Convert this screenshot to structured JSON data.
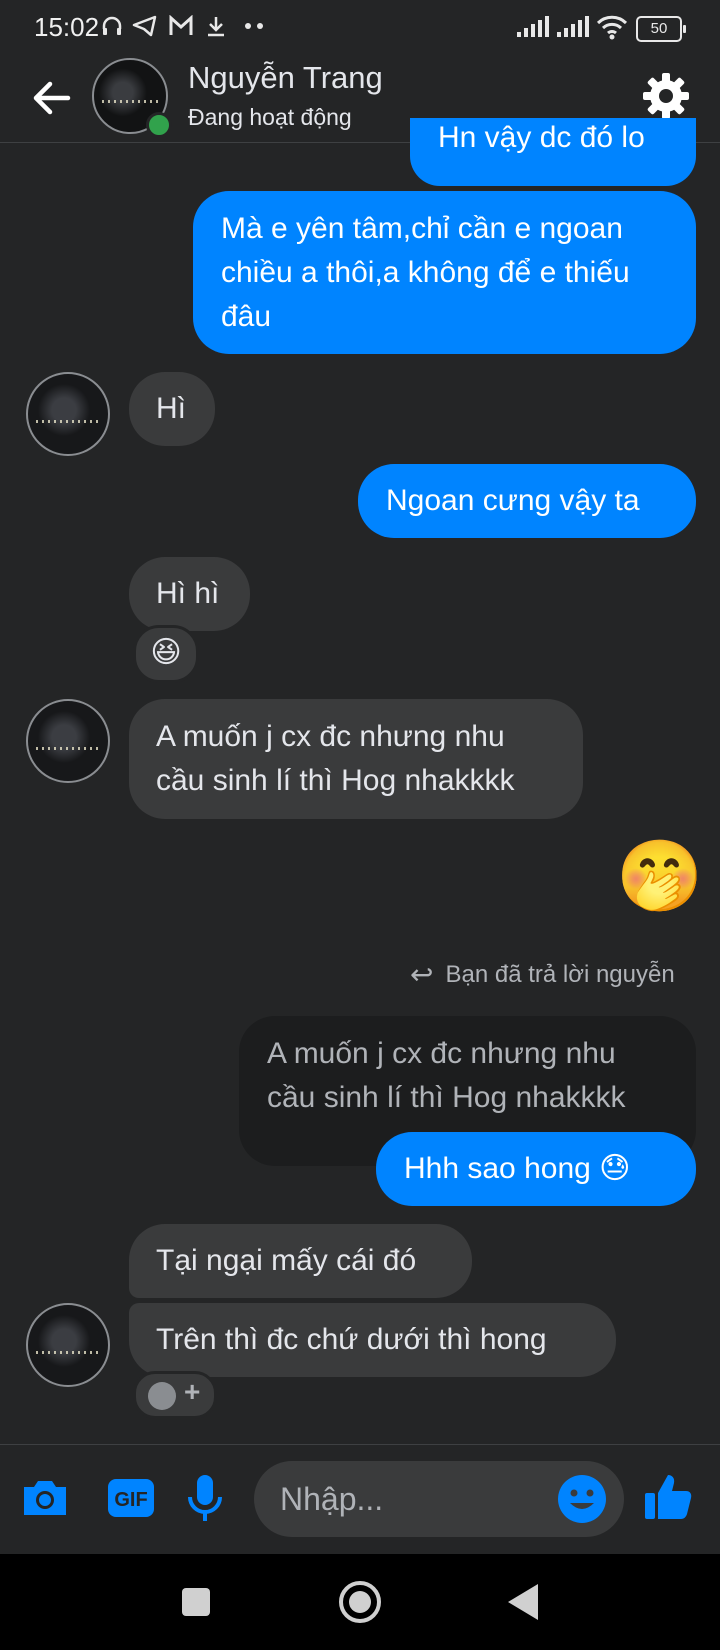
{
  "status_bar": {
    "time": "15:02",
    "battery": "50",
    "icons": [
      "headset-icon",
      "telegram-icon",
      "gmail-icon",
      "download-icon",
      "more-dots-icon",
      "signal-icon",
      "signal-icon",
      "wifi-icon",
      "battery-icon"
    ]
  },
  "header": {
    "name": "Nguyễn Trang",
    "status": "Đang hoạt động"
  },
  "messages": [
    {
      "dir": "out",
      "text": "Hn vậy dc đó lo"
    },
    {
      "dir": "out",
      "text": "Mà e yên tâm,chỉ cần e ngoan chiều a thôi,a không để e thiếu đâu"
    },
    {
      "dir": "in",
      "text": "Hì"
    },
    {
      "dir": "out",
      "text": "Ngoan cưng vậy ta"
    },
    {
      "dir": "in",
      "text": "Hì hì",
      "reaction": "😆"
    },
    {
      "dir": "in",
      "text": "A muốn j cx đc nhưng nhu cầu sinh lí thì Hog nhakkkk"
    },
    {
      "dir": "out",
      "text": "🤭"
    },
    {
      "dir": "out",
      "text": "Hhh sao hong 😓"
    },
    {
      "dir": "in",
      "text": "Tại ngại mấy cái đó"
    },
    {
      "dir": "in",
      "text": "Trên thì đc chứ dưới thì hong"
    }
  ],
  "reply": {
    "label": "Bạn đã trả lời nguyễn",
    "quoted": "A muốn j cx đc nhưng nhu cầu sinh lí thì Hog nhakkkk"
  },
  "composer": {
    "placeholder": "Nhập..."
  },
  "colors": {
    "background": "#242526",
    "outgoing_bubble": "#0084ff",
    "incoming_bubble": "#3a3b3c",
    "accent": "#0084ff",
    "online": "#31a24c"
  }
}
